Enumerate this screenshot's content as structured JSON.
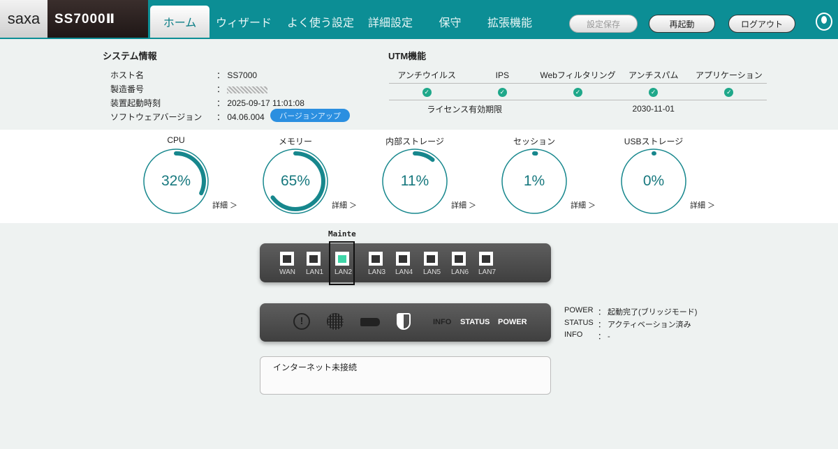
{
  "header": {
    "logo": "saxa",
    "model": "SS7000Ⅱ",
    "tabs": [
      "ホーム",
      "ウィザード",
      "よく使う設定",
      "詳細設定",
      "保守",
      "拡張機能"
    ],
    "buttons": {
      "save": "設定保存",
      "reboot": "再起動",
      "logout": "ログアウト"
    }
  },
  "system": {
    "title": "システム情報",
    "rows": [
      {
        "label": "ホスト名",
        "value": "： SS7000"
      },
      {
        "label": "製造番号",
        "value": "："
      },
      {
        "label": "装置起動時刻",
        "value": "： 2025-09-17 11:01:08"
      },
      {
        "label": "ソフトウェアバージョン",
        "value": "： 04.06.004"
      }
    ],
    "version_up": "バージョンアップ"
  },
  "utm": {
    "title": "UTM機能",
    "features": [
      "アンチウイルス",
      "IPS",
      "Webフィルタリング",
      "アンチスパム",
      "アプリケーション"
    ],
    "license_label": "ライセンス有効期限",
    "license_date": "2030-11-01"
  },
  "gauges": [
    {
      "label": "CPU",
      "value": "32%",
      "pct": 32
    },
    {
      "label": "メモリー",
      "value": "65%",
      "pct": 65
    },
    {
      "label": "内部ストレージ",
      "value": "11%",
      "pct": 11
    },
    {
      "label": "セッション",
      "value": "1%",
      "pct": 1
    },
    {
      "label": "USBストレージ",
      "value": "0%",
      "pct": 0
    }
  ],
  "detail_label": "詳細 ＞",
  "ports": {
    "mainte_label": "Mainte",
    "list": [
      "WAN",
      "LAN1",
      "LAN2",
      "LAN3",
      "LAN4",
      "LAN5",
      "LAN6",
      "LAN7"
    ]
  },
  "indicators": {
    "info": "INFO",
    "status": "STATUS",
    "power": "POWER"
  },
  "status": [
    {
      "label": "POWER",
      "value": "： 起動完了(ブリッジモード)"
    },
    {
      "label": "STATUS",
      "value": "： アクティベーション済み"
    },
    {
      "label": "INFO",
      "value": "： -"
    }
  ],
  "message": "インターネット未接続",
  "colors": {
    "header": "#0c8e95",
    "gauge": "#17878d",
    "active_port": "#3fd6a8"
  }
}
